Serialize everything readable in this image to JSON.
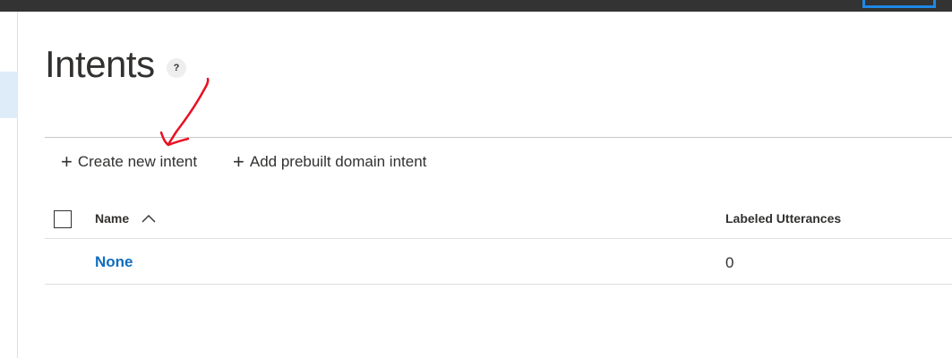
{
  "page": {
    "title": "Intents",
    "help_label": "?"
  },
  "commands": {
    "create_label": "Create new intent",
    "prebuilt_label": "Add prebuilt domain intent"
  },
  "table": {
    "columns": [
      "Name",
      "Labeled Utterances"
    ],
    "sort": {
      "column": "Name",
      "direction": "ascending"
    },
    "rows": [
      {
        "name": "None",
        "labeled_utterances": "0"
      }
    ]
  },
  "icons": {
    "help": "question-icon",
    "add": "plus-icon",
    "sort": "chevron-up-icon",
    "annotation": "hand-drawn-arrow"
  },
  "colors": {
    "topbar": "#333333",
    "accent": "#1e88e5",
    "link": "#106ebe",
    "annotation": "#e81123"
  }
}
